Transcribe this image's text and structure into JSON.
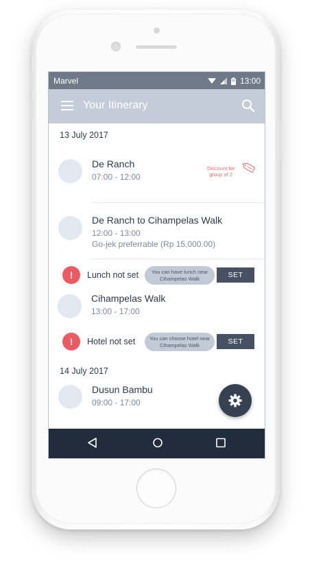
{
  "status_bar": {
    "carrier": "Marvel",
    "time": "13:00"
  },
  "app_bar": {
    "title": "Your Itinerary"
  },
  "itinerary": {
    "day1_date": "13 July 2017",
    "stop1": {
      "title": "De Ranch",
      "time": "07:00 - 12:00"
    },
    "discount": {
      "line1": "Discount for",
      "line2": "group of 2"
    },
    "transit": {
      "title": "De Ranch to Cihampelas Walk",
      "time": "12:00 - 13:00",
      "note": "Go-jek preferrable (Rp 15,000.00)"
    },
    "lunch_alert": {
      "label": "Lunch not set",
      "hint_line1": "You can have lunch  near",
      "hint_line2": "Cihampelas Walk",
      "button": "SET"
    },
    "stop2": {
      "title": "Cihampelas Walk",
      "time": "13:00 - 17:00"
    },
    "hotel_alert": {
      "label": "Hotel not set",
      "hint_line1": "You can choose hotel  near",
      "hint_line2": "Cihampelas Walk",
      "button": "SET"
    },
    "day2_date": "14 July 2017",
    "stop3": {
      "title": "Dusun Bambu",
      "time": "09:00 - 17:00"
    }
  },
  "icons": {
    "menu": "hamburger-icon",
    "search": "search-icon",
    "alert": "exclamation-icon",
    "fab": "gear-icon",
    "tag": "tag-icon",
    "nav": [
      "back-triangle-icon",
      "home-circle-icon",
      "recents-square-icon"
    ]
  },
  "colors": {
    "app_bar": "#c3ccd8",
    "status_bar": "#707987",
    "alert_red": "#ef5a60",
    "dark_button": "#465263",
    "nav_bar": "#212d3c",
    "discount_red": "#ef6a6a"
  }
}
